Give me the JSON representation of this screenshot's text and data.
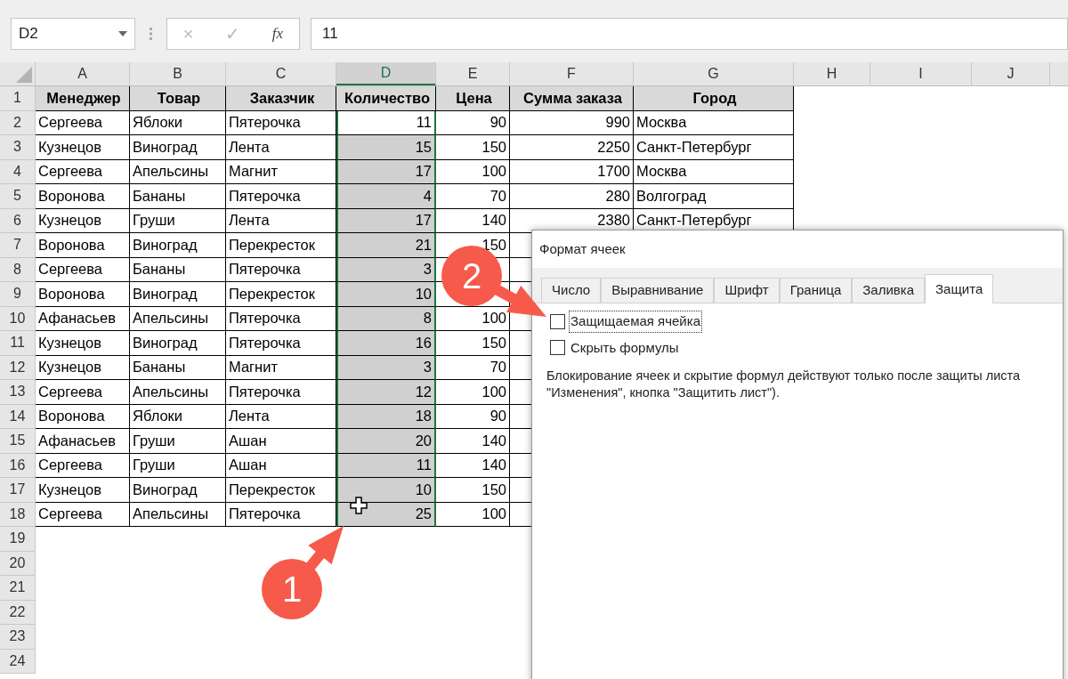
{
  "formula_bar": {
    "name_box": "D2",
    "cancel": "×",
    "enter": "✓",
    "function": "fx",
    "formula": "11"
  },
  "columns": [
    {
      "letter": "A",
      "selected": false
    },
    {
      "letter": "B",
      "selected": false
    },
    {
      "letter": "C",
      "selected": false
    },
    {
      "letter": "D",
      "selected": true
    },
    {
      "letter": "E",
      "selected": false
    },
    {
      "letter": "F",
      "selected": false
    },
    {
      "letter": "G",
      "selected": false
    },
    {
      "letter": "H",
      "selected": false
    },
    {
      "letter": "I",
      "selected": false
    },
    {
      "letter": "J",
      "selected": false
    }
  ],
  "rows": [
    {
      "number": "1",
      "kind": "header",
      "cells": [
        "Менеджер",
        "Товар",
        "Заказчик",
        "Количество",
        "Цена",
        "Сумма заказа",
        "Город"
      ]
    },
    {
      "number": "2",
      "kind": "data",
      "cells": [
        "Сергеева",
        "Яблоки",
        "Пятерочка",
        "11",
        "90",
        "990",
        "Москва"
      ]
    },
    {
      "number": "3",
      "kind": "data",
      "cells": [
        "Кузнецов",
        "Виноград",
        "Лента",
        "15",
        "150",
        "2250",
        "Санкт-Петербург"
      ]
    },
    {
      "number": "4",
      "kind": "data",
      "cells": [
        "Сергеева",
        "Апельсины",
        "Магнит",
        "17",
        "100",
        "1700",
        "Москва"
      ]
    },
    {
      "number": "5",
      "kind": "data",
      "cells": [
        "Воронова",
        "Бананы",
        "Пятерочка",
        "4",
        "70",
        "280",
        "Волгоград"
      ]
    },
    {
      "number": "6",
      "kind": "data",
      "cells": [
        "Кузнецов",
        "Груши",
        "Лента",
        "17",
        "140",
        "2380",
        "Санкт-Петербург"
      ]
    },
    {
      "number": "7",
      "kind": "data",
      "cells": [
        "Воронова",
        "Виноград",
        "Перекресток",
        "21",
        "150"
      ]
    },
    {
      "number": "8",
      "kind": "data",
      "cells": [
        "Сергеева",
        "Бананы",
        "Пятерочка",
        "3"
      ]
    },
    {
      "number": "9",
      "kind": "data",
      "cells": [
        "Воронова",
        "Виноград",
        "Перекресток",
        "10"
      ]
    },
    {
      "number": "10",
      "kind": "data",
      "cells": [
        "Афанасьев",
        "Апельсины",
        "Пятерочка",
        "8",
        "100"
      ]
    },
    {
      "number": "11",
      "kind": "data",
      "cells": [
        "Кузнецов",
        "Виноград",
        "Пятерочка",
        "16",
        "150"
      ]
    },
    {
      "number": "12",
      "kind": "data",
      "cells": [
        "Кузнецов",
        "Бананы",
        "Магнит",
        "3",
        "70"
      ]
    },
    {
      "number": "13",
      "kind": "data",
      "cells": [
        "Сергеева",
        "Апельсины",
        "Пятерочка",
        "12",
        "100"
      ]
    },
    {
      "number": "14",
      "kind": "data",
      "cells": [
        "Воронова",
        "Яблоки",
        "Лента",
        "18",
        "90"
      ]
    },
    {
      "number": "15",
      "kind": "data",
      "cells": [
        "Афанасьев",
        "Груши",
        "Ашан",
        "20",
        "140"
      ]
    },
    {
      "number": "16",
      "kind": "data",
      "cells": [
        "Сергеева",
        "Груши",
        "Ашан",
        "11",
        "140"
      ]
    },
    {
      "number": "17",
      "kind": "data",
      "cells": [
        "Кузнецов",
        "Виноград",
        "Перекресток",
        "10",
        "150"
      ]
    },
    {
      "number": "18",
      "kind": "data",
      "cells": [
        "Сергеева",
        "Апельсины",
        "Пятерочка",
        "25",
        "100"
      ]
    },
    {
      "number": "19",
      "kind": "empty"
    },
    {
      "number": "20",
      "kind": "empty"
    },
    {
      "number": "21",
      "kind": "empty"
    },
    {
      "number": "22",
      "kind": "empty"
    },
    {
      "number": "23",
      "kind": "empty"
    },
    {
      "number": "24",
      "kind": "empty"
    }
  ],
  "dialog": {
    "title": "Формат ячеек",
    "tabs": [
      {
        "label": "Число",
        "selected": false
      },
      {
        "label": "Выравнивание",
        "selected": false
      },
      {
        "label": "Шрифт",
        "selected": false
      },
      {
        "label": "Граница",
        "selected": false
      },
      {
        "label": "Заливка",
        "selected": false
      },
      {
        "label": "Защита",
        "selected": true
      }
    ],
    "checkboxes": [
      {
        "label": "Защищаемая ячейка",
        "checked": false,
        "focused": true
      },
      {
        "label": "Скрыть формулы",
        "checked": false,
        "focused": false
      }
    ],
    "note_lines": [
      "Блокирование ячеек и скрытие формул действуют только после защиты листа",
      "\"Изменения\", кнопка \"Защитить лист\")."
    ]
  },
  "callouts": [
    {
      "label": "1"
    },
    {
      "label": "2"
    }
  ]
}
